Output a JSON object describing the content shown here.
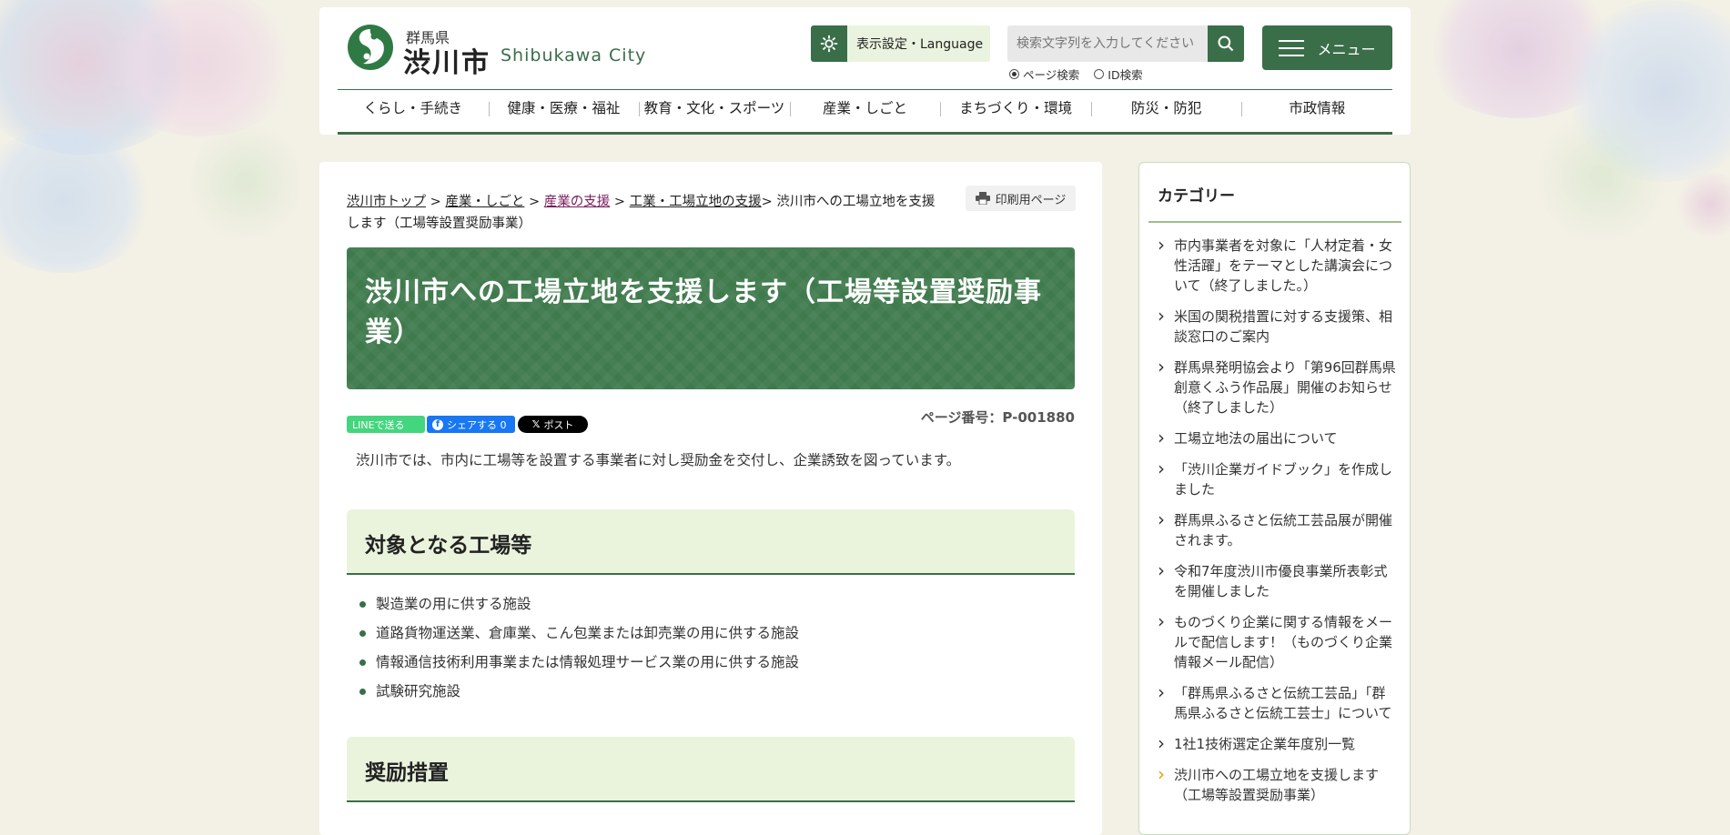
{
  "header": {
    "pref": "群馬県",
    "city": "渋川市",
    "city_en": "Shibukawa City",
    "lang_label": "表示設定・Language",
    "search_placeholder": "検索文字列を入力してください",
    "radio_page": "ページ検索",
    "radio_id": "ID検索",
    "menu_label": "メニュー"
  },
  "nav": [
    "くらし・手続き",
    "健康・医療・福祉",
    "教育・文化・スポーツ",
    "産業・しごと",
    "まちづくり・環境",
    "防災・防犯",
    "市政情報"
  ],
  "breadcrumb": {
    "items": [
      "渋川市トップ",
      "産業・しごと",
      "産業の支援",
      "工業・工場立地の支援"
    ],
    "current": "渋川市への工場立地を支援します（工場等設置奨励事業）",
    "sep": " > ",
    "sep_last": "> "
  },
  "print_label": "印刷用ページ",
  "title": "渋川市への工場立地を支援します（工場等設置奨励事業）",
  "share": {
    "line": "LINEで送る",
    "fb": "シェアする 0",
    "x": "ポスト"
  },
  "page_number": "ページ番号：P-001880",
  "intro": "渋川市では、市内に工場等を設置する事業者に対し奨励金を交付し、企業誘致を図っています。",
  "section1": {
    "heading": "対象となる工場等",
    "items": [
      "製造業の用に供する施設",
      "道路貨物運送業、倉庫業、こん包業または卸売業の用に供する施設",
      "情報通信技術利用事業または情報処理サービス業の用に供する施設",
      "試験研究施設"
    ]
  },
  "section2": {
    "heading": "奨励措置"
  },
  "sidebar": {
    "title": "カテゴリー",
    "items": [
      "市内事業者を対象に「人材定着・女性活躍」をテーマとした講演会について（終了しました。）",
      "米国の関税措置に対する支援策、相談窓口のご案内",
      "群馬県発明協会より「第96回群馬県創意くふう作品展」開催のお知らせ（終了しました）",
      "工場立地法の届出について",
      "「渋川企業ガイドブック」を作成しました",
      "群馬県ふるさと伝統工芸品展が開催されます。",
      "令和7年度渋川市優良事業所表彰式を開催しました",
      "ものづくり企業に関する情報をメールで配信します！（ものづくり企業情報メール配信）",
      "「群馬県ふるさと伝統工芸品」「群馬県ふるさと伝統工芸士」について",
      "1社1技術選定企業年度別一覧",
      "渋川市への工場立地を支援します（工場等設置奨励事業）"
    ]
  },
  "colors": {
    "brand_green": "#3a6e49",
    "title_green": "#3f7a4d",
    "light_green": "#eaf4dd",
    "current_marker": "#e0a000"
  }
}
